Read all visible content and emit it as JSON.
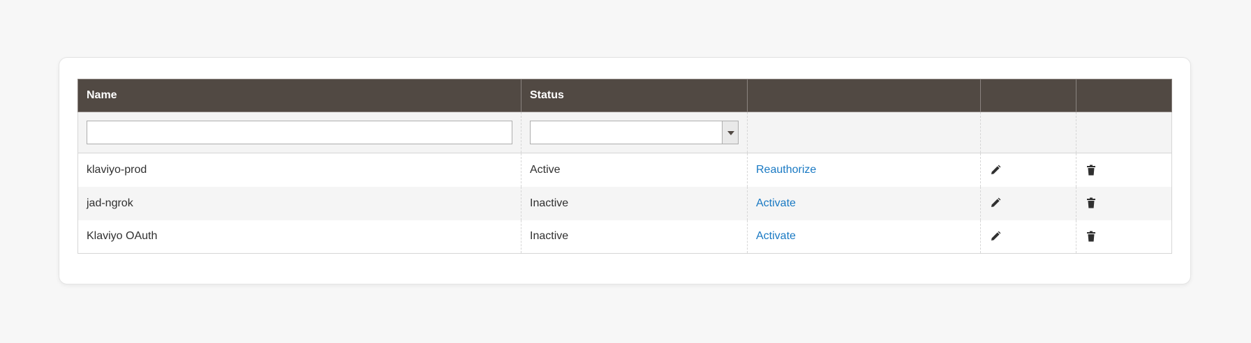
{
  "grid": {
    "columns": [
      {
        "label": "Name"
      },
      {
        "label": "Status"
      },
      {
        "label": ""
      },
      {
        "label": ""
      },
      {
        "label": ""
      }
    ],
    "filters": {
      "name_value": "",
      "status_value": ""
    },
    "rows": [
      {
        "name": "klaviyo-prod",
        "status": "Active",
        "action": "Reauthorize",
        "edit_icon": "pencil-icon",
        "delete_icon": "trash-icon"
      },
      {
        "name": "jad-ngrok",
        "status": "Inactive",
        "action": "Activate",
        "edit_icon": "pencil-icon",
        "delete_icon": "trash-icon"
      },
      {
        "name": "Klaviyo OAuth",
        "status": "Inactive",
        "action": "Activate",
        "edit_icon": "pencil-icon",
        "delete_icon": "trash-icon"
      }
    ]
  },
  "colors": {
    "header_bg": "#514943",
    "link": "#1979c3",
    "page_bg": "#f7f7f7"
  }
}
